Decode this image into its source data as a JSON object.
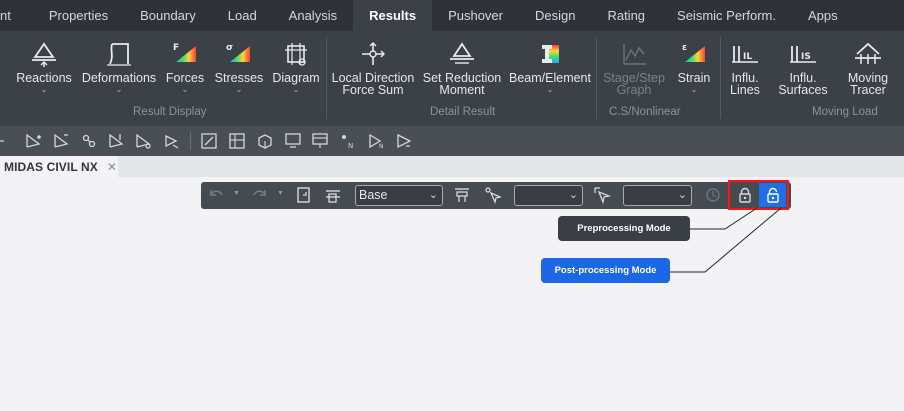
{
  "menu_tabs": [
    {
      "label": "nt",
      "active": false
    },
    {
      "label": "Properties",
      "active": false
    },
    {
      "label": "Boundary",
      "active": false
    },
    {
      "label": "Load",
      "active": false
    },
    {
      "label": "Analysis",
      "active": false
    },
    {
      "label": "Results",
      "active": true
    },
    {
      "label": "Pushover",
      "active": false
    },
    {
      "label": "Design",
      "active": false
    },
    {
      "label": "Rating",
      "active": false
    },
    {
      "label": "Seismic Perform.",
      "active": false
    },
    {
      "label": "Apps",
      "active": false
    }
  ],
  "ribbon": {
    "buttons": {
      "reactions": {
        "label": "Reactions",
        "icon": "reactions-icon"
      },
      "deformations": {
        "label": "Deformations",
        "icon": "deformations-icon"
      },
      "forces": {
        "label": "Forces",
        "icon": "forces-icon"
      },
      "stresses": {
        "label": "Stresses",
        "icon": "stresses-icon"
      },
      "diagram": {
        "label": "Diagram",
        "icon": "diagram-icon"
      },
      "local_direction_line1": "Local Direction",
      "local_direction_line2": "Force Sum",
      "set_reduction_line1": "Set Reduction",
      "set_reduction_line2": "Moment",
      "beam_element": {
        "label": "Beam/Element",
        "icon": "beam-element-icon"
      },
      "stage_step_line1": "Stage/Step",
      "stage_step_line2": "Graph",
      "strain": {
        "label": "Strain",
        "icon": "strain-icon"
      },
      "influ_lines_line1": "Influ.",
      "influ_lines_line2": "Lines",
      "influ_surfaces_line1": "Influ.",
      "influ_surfaces_line2": "Surfaces",
      "moving_tracer_line1": "Moving",
      "moving_tracer_line2": "Tracer"
    },
    "groups": {
      "result_display": "Result Display",
      "detail_result": "Detail Result",
      "cs_nonlinear": "C.S/Nonlinear",
      "moving_load": "Moving Load"
    }
  },
  "doc_tab": {
    "title": "MIDAS CIVIL NX",
    "close": "✕"
  },
  "floating_toolbar": {
    "stage_select_value": "Base",
    "select2_value": "",
    "select3_value": ""
  },
  "callouts": {
    "preprocessing": "Preprocessing Mode",
    "postprocessing": "Post-processing Mode"
  },
  "colors": {
    "accent_blue": "#1f6fe8",
    "highlight_red": "#ff1212",
    "tabbar_bg": "#2f3237",
    "ribbon_bg": "#3c4047"
  }
}
